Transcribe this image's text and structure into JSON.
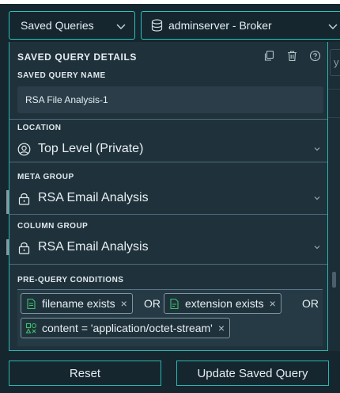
{
  "header": {
    "saved_queries_label": "Saved Queries",
    "server_label": "adminserver - Broker"
  },
  "backdrop": {
    "field_fragment": "y"
  },
  "panel": {
    "title": "SAVED QUERY DETAILS",
    "icons": [
      "copy-icon",
      "trash-icon",
      "help-icon"
    ],
    "name_label": "SAVED QUERY NAME",
    "name_value": "RSA File Analysis-1",
    "location_label": "LOCATION",
    "location_value": "Top Level (Private)",
    "meta_group_label": "META GROUP",
    "meta_group_value": "RSA Email Analysis",
    "column_group_label": "COLUMN GROUP",
    "column_group_value": "RSA Email Analysis",
    "conditions_label": "PRE-QUERY CONDITIONS",
    "conditions": [
      {
        "text": "filename exists",
        "icon": "file-text-icon"
      },
      {
        "operator": "OR"
      },
      {
        "text": "extension exists",
        "icon": "file-meta-icon"
      },
      {
        "operator": "OR"
      },
      {
        "text": "content = 'application/octet-stream'",
        "icon": "shapes-icon"
      }
    ],
    "operators": [
      "OR",
      "OR"
    ],
    "condition_pills": [
      {
        "text": "filename exists",
        "remove": "×"
      },
      {
        "text": "extension exists",
        "remove": "×"
      },
      {
        "text": "content = 'application/octet-stream'",
        "remove": "×"
      }
    ]
  },
  "footer": {
    "reset_label": "Reset",
    "update_label": "Update Saved Query"
  },
  "colors": {
    "accent": "#2bb5b0",
    "panel_bg": "#1f323c",
    "header_bg": "#15262f",
    "pill_icon_green": "#3fbf6a"
  }
}
